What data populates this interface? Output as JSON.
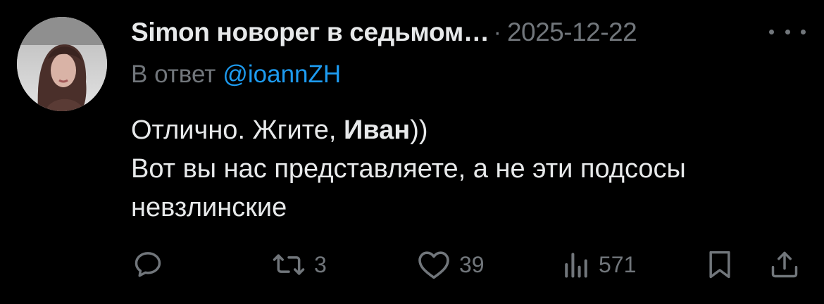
{
  "tweet": {
    "display_name": "Simon новорег в седьмом…",
    "separator": "·",
    "timestamp": "2025-12-22",
    "reply_prefix": "В ответ",
    "reply_to": "@ioannZH",
    "body": {
      "line1_pre": "Отлично. Жгите, ",
      "line1_bold": "Иван",
      "line1_post": "))",
      "line2": "Вот вы нас представляете, а не эти подсосы",
      "line3": "невзлинские"
    }
  },
  "actions": {
    "reply_icon": "reply-icon",
    "retweet_icon": "retweet-icon",
    "retweet_count": "3",
    "like_icon": "heart-icon",
    "like_count": "39",
    "views_icon": "views-icon",
    "views_count": "571",
    "bookmark_icon": "bookmark-icon",
    "share_icon": "share-icon"
  },
  "colors": {
    "background": "#000000",
    "primary_text": "#e7e9ea",
    "secondary_text": "#71767b",
    "link": "#1d9bf0"
  }
}
